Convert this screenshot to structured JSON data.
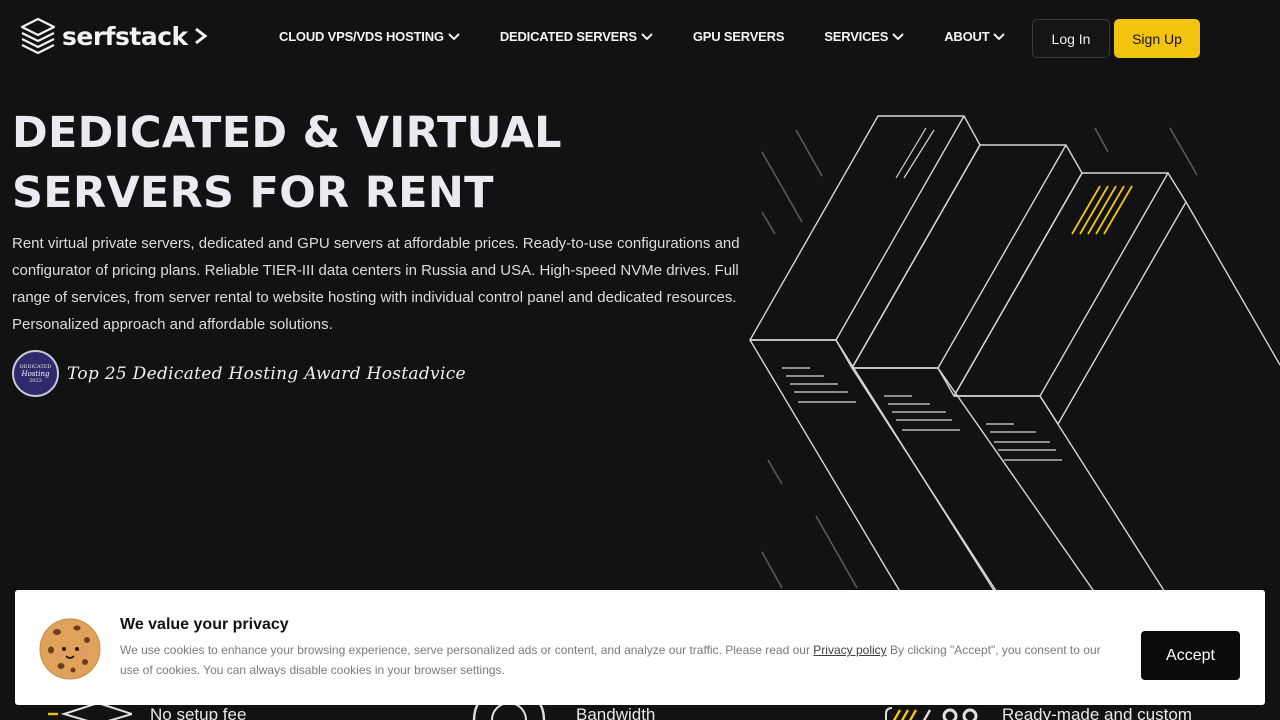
{
  "brand": {
    "name": "serfstack",
    "accent": "#f2c40f"
  },
  "nav": {
    "items": [
      {
        "label": "CLOUD VPS/VDS HOSTING",
        "dropdown": true
      },
      {
        "label": "DEDICATED SERVERS",
        "dropdown": true
      },
      {
        "label": "GPU SERVERS",
        "dropdown": false
      },
      {
        "label": "SERVICES",
        "dropdown": true
      },
      {
        "label": "ABOUT",
        "dropdown": true
      }
    ],
    "login_label": "Log In",
    "signup_label": "Sign Up"
  },
  "hero": {
    "title": "DEDICATED & VIRTUAL SERVERS FOR RENT",
    "description": "Rent virtual private servers, dedicated and GPU servers at affordable prices. Ready-to-use configurations and configurator of pricing plans. Reliable TIER-III data centers in Russia and USA. High-speed NVMe drives. Full range of services, from server rental to website hosting with individual control panel and dedicated resources. Personalized approach and affordable solutions.",
    "award": {
      "badge_line1": "DEDICATED",
      "badge_line2": "Hosting",
      "badge_year": "2023",
      "text": "Top 25 Dedicated Hosting Award Hostadvice"
    }
  },
  "features": [
    {
      "label": "No setup fee",
      "icon": "box-icon"
    },
    {
      "label": "Bandwidth",
      "icon": "gauge-icon"
    },
    {
      "label": "Ready-made and custom",
      "icon": "config-icon"
    }
  ],
  "cookie": {
    "title": "We value your privacy",
    "text_before": "We use cookies to enhance your browsing experience, serve personalized ads or content, and analyze our traffic. Please read our ",
    "link_label": "Privacy policy",
    "text_after": " By clicking \"Accept\", you consent to our use of cookies. You can always disable cookies in your browser settings.",
    "accept_label": "Accept"
  }
}
